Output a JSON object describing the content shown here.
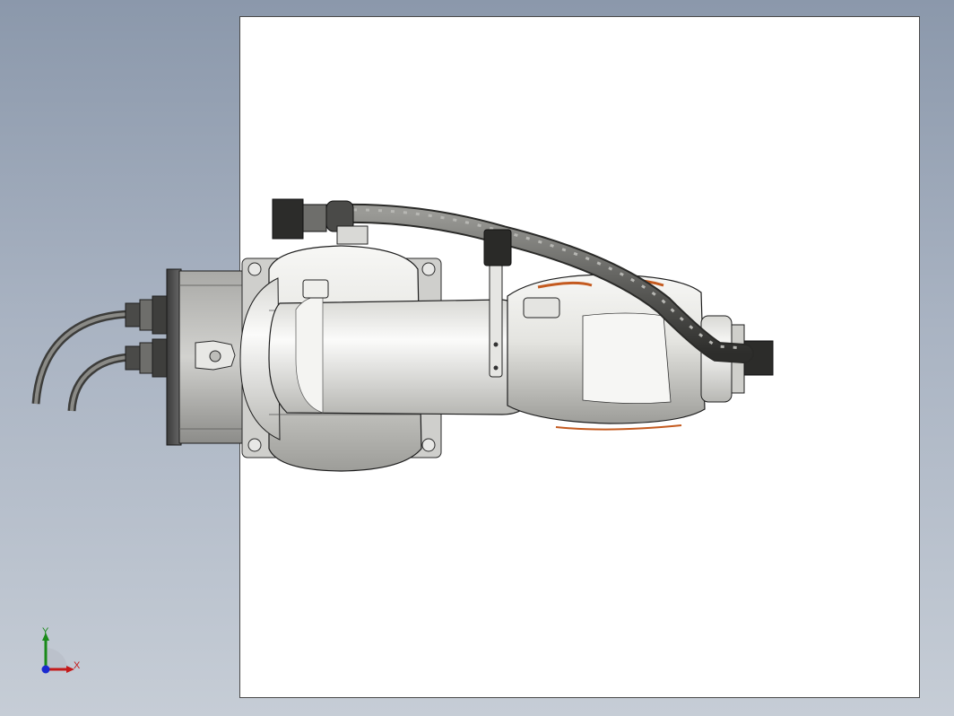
{
  "viewport": {
    "background_top": "#8b98ab",
    "background_bottom": "#c6cdd6",
    "sheet_color": "#ffffff",
    "model_name": "robot-arm-top-view"
  },
  "triad": {
    "x_label": "X",
    "y_label": "Y",
    "x_color": "#c41a1a",
    "y_color": "#1a8a1a",
    "z_color": "#1a2ad0"
  }
}
